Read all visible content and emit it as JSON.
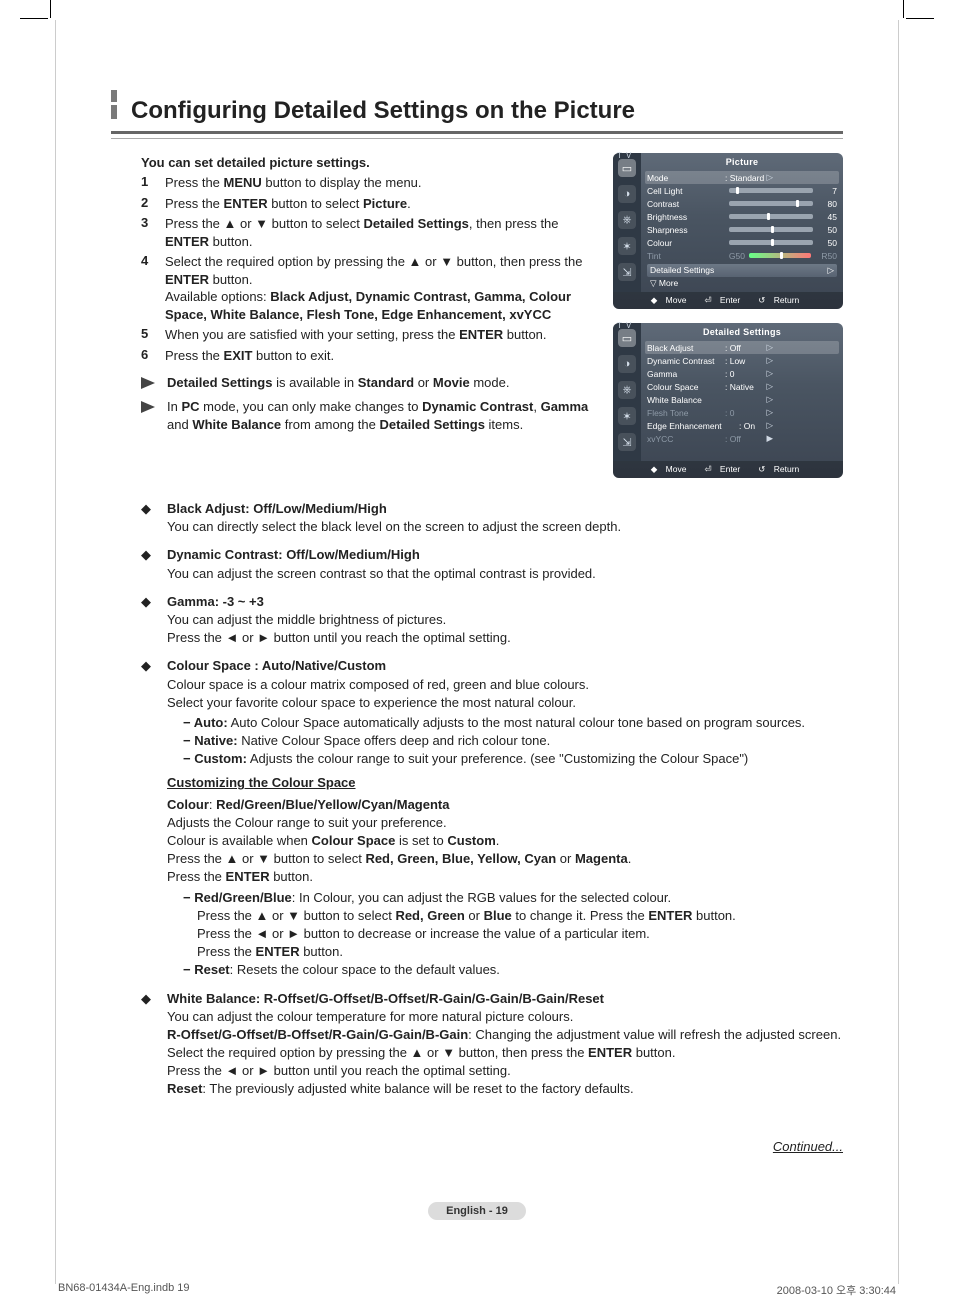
{
  "title": "Configuring Detailed Settings on the Picture",
  "intro": "You can set detailed picture settings.",
  "steps": [
    {
      "n": "1",
      "pre": "Press the ",
      "b1": "MENU",
      "post": " button to display the menu."
    },
    {
      "n": "2",
      "pre": "Press the ",
      "b1": "ENTER",
      "mid": " button to select ",
      "b2": "Picture",
      "post": "."
    },
    {
      "n": "3",
      "pre": "Press the ▲ or ▼ button to select ",
      "b1": "Detailed Settings",
      "mid": ", then press the ",
      "b2": "ENTER",
      "post": " button."
    },
    {
      "n": "4",
      "pre": "Select the required option by pressing the ▲ or ▼ button, then press the ",
      "b1": "ENTER",
      "post": " button.",
      "extra_pre": "Available options: ",
      "extra_list": "Black Adjust, Dynamic Contrast, Gamma, Colour Space, White Balance, Flesh Tone, Edge Enhancement, xvYCC"
    },
    {
      "n": "5",
      "pre": "When you are satisfied with your setting, press the ",
      "b1": "ENTER",
      "post": " button."
    },
    {
      "n": "6",
      "pre": "Press the ",
      "b1": "EXIT",
      "post": " button to exit."
    }
  ],
  "notes": [
    {
      "pre": "",
      "b1": "Detailed Settings",
      "mid": " is available in ",
      "b2": "Standard",
      "mid2": " or ",
      "b3": "Movie",
      "post": " mode."
    },
    {
      "pre": "In ",
      "b1": "PC",
      "mid": " mode, you can only make changes to ",
      "b2": "Dynamic Contrast",
      "mid2": ", ",
      "b3": "Gamma",
      "mid3": " and ",
      "b4": "White Balance",
      "post": " from among the ",
      "b5": "Detailed Settings",
      "post2": " items."
    }
  ],
  "bullets": {
    "black": {
      "head": "Black Adjust: Off/Low/Medium/High",
      "body": "You can directly select the black level on the screen to adjust the screen depth."
    },
    "dyn": {
      "head": "Dynamic Contrast: Off/Low/Medium/High",
      "body": "You can adjust the screen contrast so that the optimal contrast is provided."
    },
    "gamma": {
      "head": "Gamma: -3 ~ +3",
      "l1": "You can adjust the middle brightness of pictures.",
      "l2": "Press the ◄ or ► button until you reach the optimal setting."
    },
    "cspace": {
      "head": "Colour Space : Auto/Native/Custom",
      "l1": "Colour space is a colour matrix composed of red, green and blue colours.",
      "l2": "Select your favorite colour space to experience the most natural colour.",
      "auto_b": "Auto:",
      "auto": " Auto Colour Space automatically adjusts to the most natural colour tone based on program sources.",
      "native_b": "Native:",
      "native": " Native Colour Space offers deep and rich colour tone.",
      "custom_b": "Custom:",
      "custom": " Adjusts the colour range to suit your preference. (see \"Customizing the Colour Space\")"
    },
    "customizing": {
      "subhead": "Customizing the Colour Space",
      "colour_line_pre": "Colour",
      "colour_line_mid": ": ",
      "colour_line_opts": "Red/Green/Blue/Yellow/Cyan/Magenta",
      "p1": "Adjusts the Colour range to suit your preference.",
      "p2_pre": "Colour is available when ",
      "p2_b": "Colour Space",
      "p2_mid": " is set to ",
      "p2_b2": "Custom",
      "p2_post": ".",
      "p3_pre": "Press the ▲ or ▼ button to select ",
      "p3_list": "Red, Green, Blue, Yellow, Cyan",
      "p3_or": " or ",
      "p3_last": "Magenta",
      "p3_post": ".",
      "p4_pre": "Press the ",
      "p4_b": "ENTER",
      "p4_post": " button.",
      "rgb_b": "Red/Green/Blue",
      "rgb_1": ": In Colour, you can adjust the RGB values for the selected colour.",
      "rgb_2_pre": "Press the ▲ or ▼ button to select ",
      "rgb_2_list": "Red, Green",
      "rgb_2_or": " or ",
      "rgb_2_last": "Blue",
      "rgb_2_mid": " to change it. Press the ",
      "rgb_2_b": "ENTER",
      "rgb_2_post": " button.",
      "rgb_3": "Press the ◄ or ► button to decrease or increase the value of a particular item.",
      "rgb_4_pre": "Press the ",
      "rgb_4_b": "ENTER",
      "rgb_4_post": " button.",
      "reset_b": "Reset",
      "reset": ": Resets the colour space to the default values."
    },
    "wb": {
      "head": "White Balance: R-Offset/G-Offset/B-Offset/R-Gain/G-Gain/B-Gain/Reset",
      "l1": "You can adjust the colour temperature for more natural picture colours.",
      "l2_b": "R-Offset/G-Offset/B-Offset/R-Gain/G-Gain/B-Gain",
      "l2": ": Changing the adjustment value will refresh the adjusted screen.",
      "l3_pre": "Select the required option by pressing the ▲ or ▼ button, then press the ",
      "l3_b": "ENTER",
      "l3_post": " button.",
      "l4": "Press the ◄ or ► button until you reach the optimal setting.",
      "l5_b": "Reset",
      "l5": ": The previously adjusted white balance will be reset to the factory defaults."
    }
  },
  "osd1": {
    "tv": "T V",
    "title": "Picture",
    "rows": [
      {
        "lbl": "Mode",
        "val": ": Standard",
        "arrow": "▷",
        "sel": true
      },
      {
        "lbl": "Cell Light",
        "slider": "v7",
        "num": "7"
      },
      {
        "lbl": "Contrast",
        "slider": "v80",
        "num": "80"
      },
      {
        "lbl": "Brightness",
        "slider": "v45",
        "num": "45"
      },
      {
        "lbl": "Sharpness",
        "slider": "v50",
        "num": "50"
      },
      {
        "lbl": "Colour",
        "slider": "v50b",
        "num": "50"
      },
      {
        "lbl": "Tint",
        "g": "G50",
        "r": "R50",
        "tint": true,
        "dim": true
      }
    ],
    "detail_label": "Detailed Settings",
    "detail_arrow": "▷",
    "more": "More",
    "foot": {
      "move": "Move",
      "enter": "Enter",
      "ret": "Return"
    }
  },
  "osd2": {
    "tv": "T V",
    "title": "Detailed Settings",
    "rows": [
      {
        "lbl": "Black Adjust",
        "val": ": Off",
        "arrow": "▷",
        "sel": true
      },
      {
        "lbl": "Dynamic Contrast",
        "val": ": Low",
        "arrow": "▷"
      },
      {
        "lbl": "Gamma",
        "val": ":   0",
        "arrow": "▷"
      },
      {
        "lbl": "Colour Space",
        "val": ": Native",
        "arrow": "▷"
      },
      {
        "lbl": "White Balance",
        "val": "",
        "arrow": "▷"
      },
      {
        "lbl": "Flesh Tone",
        "val": ":   0",
        "arrow": "▷",
        "dim": true
      },
      {
        "lbl": "Edge Enhancement",
        "val": ": On",
        "arrow": "▷"
      },
      {
        "lbl": "xvYCC",
        "val": ": Off",
        "arrow": "▶",
        "dim": true
      }
    ],
    "foot": {
      "move": "Move",
      "enter": "Enter",
      "ret": "Return"
    }
  },
  "continued": "Continued...",
  "page_foot": "English - 19",
  "print_left": "BN68-01434A-Eng.indb   19",
  "print_right": "2008-03-10   오후 3:30:44"
}
